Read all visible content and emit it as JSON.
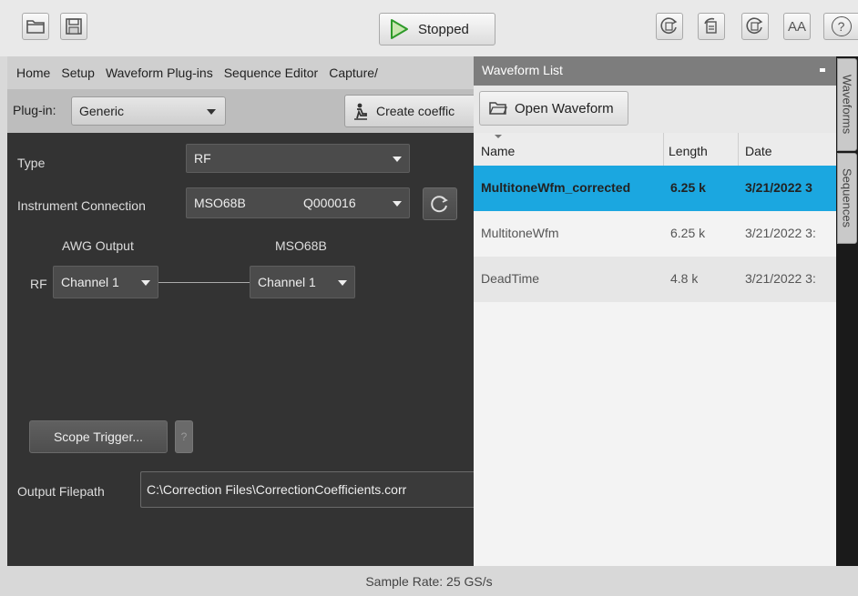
{
  "toolbar": {
    "run_label": "Stopped",
    "font_button": "AA",
    "help_button": "?"
  },
  "menu": {
    "items": [
      "Home",
      "Setup",
      "Waveform Plug-ins",
      "Sequence Editor",
      "Capture/"
    ]
  },
  "plugin": {
    "label": "Plug-in:",
    "value": "Generic",
    "create_label": "Create coeffic"
  },
  "form": {
    "type_label": "Type",
    "type_value": "RF",
    "connection_label": "Instrument Connection",
    "connection_model": "MSO68B",
    "connection_serial": "Q000016",
    "awg_output_label": "AWG Output",
    "scope_label": "MSO68B",
    "rf_label": "RF",
    "awg_channel": "Channel 1",
    "scope_channel": "Channel 1",
    "scope_trigger_label": "Scope Trigger...",
    "help_label": "?",
    "output_filepath_label": "Output Filepath",
    "output_filepath_value": "C:\\Correction Files\\CorrectionCoefficients.corr"
  },
  "waveform_list": {
    "title": "Waveform List",
    "open_label": "Open Waveform",
    "columns": [
      "Name",
      "Length",
      "Date"
    ],
    "rows": [
      {
        "name": "MultitoneWfm_corrected",
        "length": "6.25 k",
        "date": "3/21/2022 3"
      },
      {
        "name": "MultitoneWfm",
        "length": "6.25 k",
        "date": "3/21/2022 3:"
      },
      {
        "name": "DeadTime",
        "length": "4.8 k",
        "date": "3/21/2022 3:"
      }
    ],
    "selected_color": "#1ba7e0"
  },
  "side_tabs": [
    "Waveforms",
    "Sequences"
  ],
  "status": {
    "sample_rate": "Sample Rate: 25 GS/s"
  }
}
